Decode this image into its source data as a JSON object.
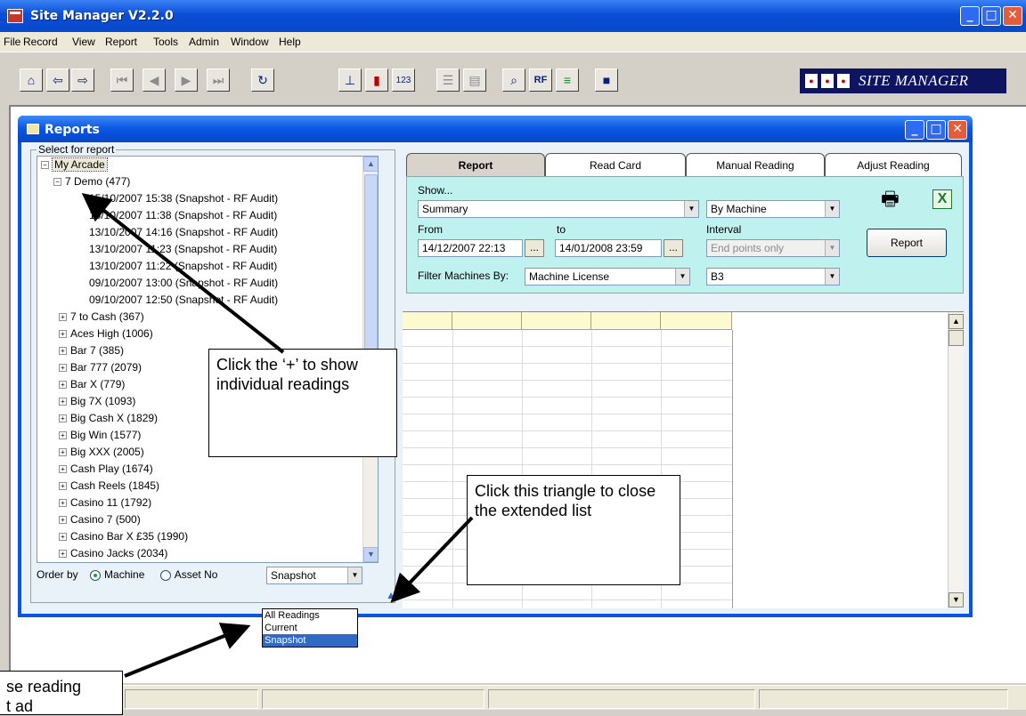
{
  "app": {
    "title": "Site Manager  V2.2.0",
    "brand_text": "SITE MANAGER",
    "colors": {
      "title_blue": "#0a4ed8",
      "filter_panel": "#bff1ef",
      "brand_navy": "#0e145f",
      "selection": "#316ac5"
    }
  },
  "menu": [
    "File",
    "Record",
    "View",
    "Report",
    "Tools",
    "Admin",
    "Window",
    "Help"
  ],
  "toolbar": {
    "buttons": [
      "home-icon",
      "back-icon",
      "forward-icon",
      "first-record-icon",
      "prev-record-icon",
      "next-record-icon",
      "last-record-icon",
      "refresh-icon",
      "meters-icon",
      "card-icon",
      "numbers-icon",
      "database-icon",
      "export-icon",
      "search-icon",
      "rf-icon",
      "chart-icon",
      "save-icon"
    ],
    "labels": {
      "numbers": "123",
      "rf": "RF"
    }
  },
  "reports_window": {
    "title": "Reports",
    "select_group_label": "Select for report",
    "tree_root": "My Arcade",
    "tree_expanded": "7 Demo (477)",
    "readings": [
      "15/10/2007 15:38 (Snapshot - RF Audit)",
      "15/10/2007 11:38 (Snapshot - RF Audit)",
      "13/10/2007 14:16 (Snapshot - RF Audit)",
      "13/10/2007 11:23 (Snapshot - RF Audit)",
      "13/10/2007 11:22 (Snapshot - RF Audit)",
      "09/10/2007 13:00 (Snapshot - RF Audit)",
      "09/10/2007 12:50 (Snapshot - RF Audit)"
    ],
    "machines": [
      "7 to Cash (367)",
      "Aces High (1006)",
      "Bar 7 (385)",
      "Bar 777 (2079)",
      "Bar X (779)",
      "Big 7X (1093)",
      "Big Cash X (1829)",
      "Big Win (1577)",
      "Big XXX (2005)",
      "Cash Play (1674)",
      "Cash Reels (1845)",
      "Casino 11 (1792)",
      "Casino 7 (500)",
      "Casino Bar X £35 (1990)",
      "Casino Jacks (2034)"
    ],
    "order_by_label": "Order by",
    "order_options": [
      "Machine",
      "Asset No"
    ],
    "order_selected": "Machine",
    "reading_type_value": "Snapshot",
    "reading_type_options": [
      "All Readings",
      "Current",
      "Snapshot"
    ],
    "tabs": [
      "Report",
      "Read Card",
      "Manual Reading",
      "Adjust Reading"
    ],
    "active_tab": "Report",
    "show_label": "Show...",
    "show_value": "Summary",
    "group_value": "By Machine",
    "from_label": "From",
    "from_value": "14/12/2007 22:13",
    "to_label": "to",
    "to_value": "14/01/2008 23:59",
    "interval_label": "Interval",
    "interval_value": "End points only",
    "filter_label": "Filter Machines By:",
    "filter_value": "Machine License",
    "filter_param": "B3",
    "report_button": "Report",
    "browse_label": "..."
  },
  "callouts": {
    "plus": "Click the ‘+’ to show individual readings",
    "triangle": "Click this triangle to close the extended list",
    "choose": "se reading\nt ad"
  }
}
